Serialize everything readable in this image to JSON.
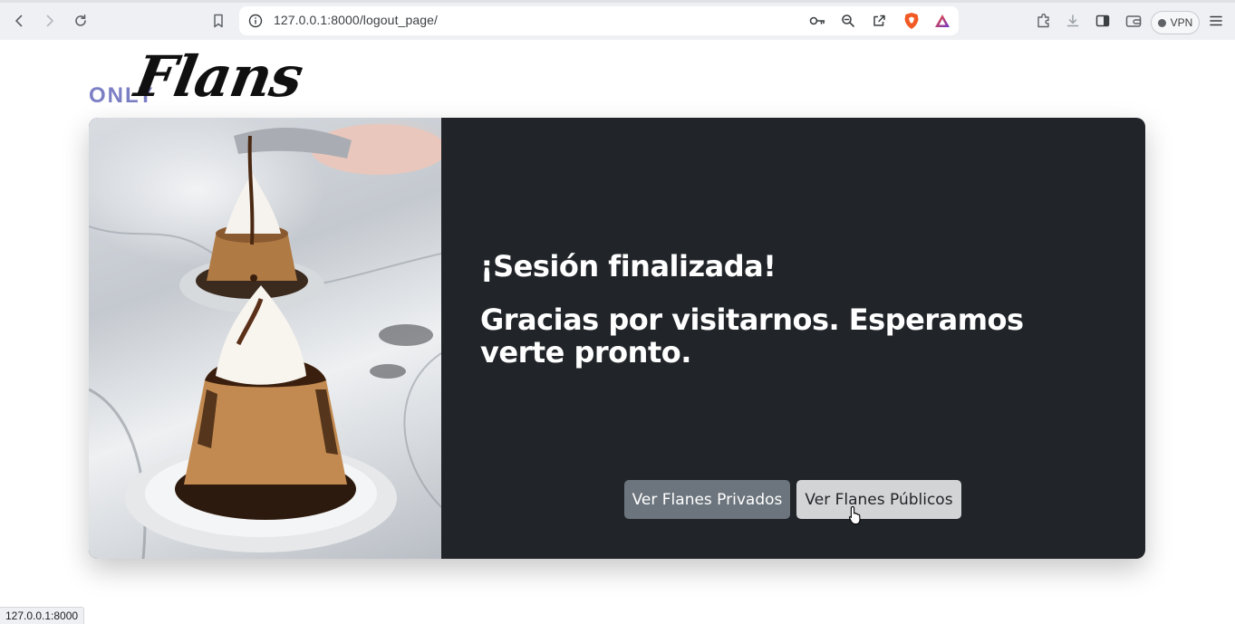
{
  "browser": {
    "url": "127.0.0.1:8000/logout_page/",
    "vpn_label": "VPN",
    "status_url": "127.0.0.1:8000"
  },
  "logo": {
    "prefix": "ONLY",
    "name": "Flans"
  },
  "card": {
    "title": "¡Sesión finalizada!",
    "message": "Gracias por visitarnos. Esperamos verte pronto.",
    "private_button": "Ver Flanes Privados",
    "public_button": "Ver Flanes Públicos"
  },
  "colors": {
    "card_bg": "#212529",
    "private_button_bg": "#6c757d",
    "public_button_bg": "#d3d4d5",
    "logo_accent": "#7b7fc4"
  },
  "icons": [
    "back-icon",
    "forward-icon",
    "reload-icon",
    "bookmark-icon",
    "site-info-icon",
    "key-icon",
    "zoom-icon",
    "share-icon",
    "brave-shields-icon",
    "brave-rewards-icon",
    "extensions-icon",
    "download-icon",
    "sidebar-icon",
    "wallet-icon",
    "menu-icon"
  ]
}
